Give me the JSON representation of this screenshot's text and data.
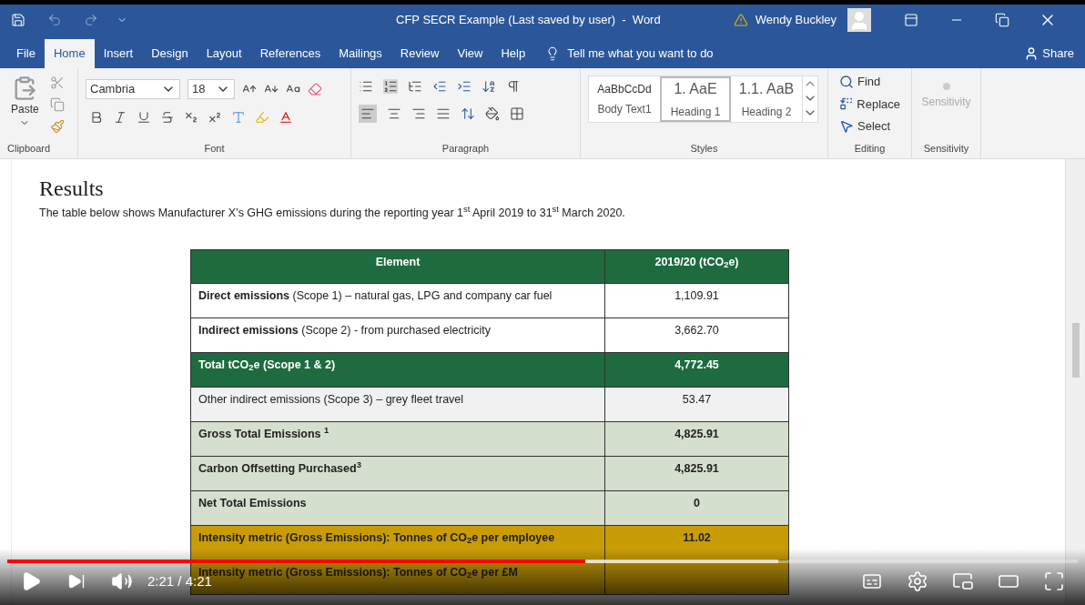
{
  "title_bar": {
    "title": "CFP SECR Example (Last saved by user)  -  Word",
    "user": "Wendy Buckley"
  },
  "menu_tabs": [
    {
      "label": "File",
      "selected": false
    },
    {
      "label": "Home",
      "selected": true
    },
    {
      "label": "Insert",
      "selected": false
    },
    {
      "label": "Design",
      "selected": false
    },
    {
      "label": "Layout",
      "selected": false
    },
    {
      "label": "References",
      "selected": false
    },
    {
      "label": "Mailings",
      "selected": false
    },
    {
      "label": "Review",
      "selected": false
    },
    {
      "label": "View",
      "selected": false
    },
    {
      "label": "Help",
      "selected": false
    }
  ],
  "tell_me": {
    "placeholder": "Tell me what you want to do"
  },
  "share": "Share",
  "ribbon": {
    "paste": "Paste",
    "font": {
      "name": "Cambria",
      "size": "18"
    },
    "styles": [
      {
        "preview": "AaBbCcDd",
        "label": "Body Text1",
        "selected": false
      },
      {
        "preview": "1.  AaE",
        "label": "Heading 1",
        "selected": true
      },
      {
        "preview": "1.1.  AaB",
        "label": "Heading 2",
        "selected": false
      }
    ],
    "editing": [
      "Find",
      "Replace",
      "Select"
    ],
    "sensitivity": "Sensitivity",
    "groups": [
      "Clipboard",
      "Font",
      "Paragraph",
      "Styles",
      "Editing",
      "Sensitivity"
    ]
  },
  "document": {
    "heading": "Results",
    "intro": "The table below shows Manufacturer X’s GHG emissions during the reporting year 1$^{st}$ April 2019 to 31$^{st}$ March 2020.",
    "table": {
      "columns": [
        "Element",
        "2019/20 (tCO$_{2}$e)"
      ],
      "rows": [
        {
          "kind": "detail",
          "cells": [
            "**Direct emissions** (Scope 1) – natural gas, LPG and company car fuel",
            "1,109.91"
          ]
        },
        {
          "kind": "detail",
          "cells": [
            "**Indirect emissions** (Scope 2) - from purchased electricity",
            "3,662.70"
          ]
        },
        {
          "kind": "total",
          "cells": [
            "Total tCO$_{2}$e (Scope 1 & 2)",
            "4,772.45"
          ]
        },
        {
          "kind": "other",
          "cells": [
            "Other indirect emissions (Scope 3) – grey fleet travel",
            "53.47"
          ]
        },
        {
          "kind": "summary",
          "cells": [
            "Gross Total Emissions $^{1}$",
            "4,825.91"
          ]
        },
        {
          "kind": "summary",
          "cells": [
            "Carbon Offsetting Purchased$^{3}$",
            "4,825.91"
          ]
        },
        {
          "kind": "summary",
          "cells": [
            "Net Total Emissions",
            "0"
          ]
        },
        {
          "kind": "intensity",
          "cells": [
            "Intensity metric (Gross Emissions): Tonnes of CO$_{2}$e per employee",
            "11.02"
          ]
        },
        {
          "kind": "intensity",
          "cells": [
            "Intensity metric  (Gross Emissions): Tonnes of CO$_{2}$e per £M",
            ""
          ]
        }
      ]
    }
  },
  "video": {
    "time": "2:21 / 4:21",
    "progress": {
      "level": 0.54
    },
    "buffer": {
      "level": 0.72
    }
  }
}
